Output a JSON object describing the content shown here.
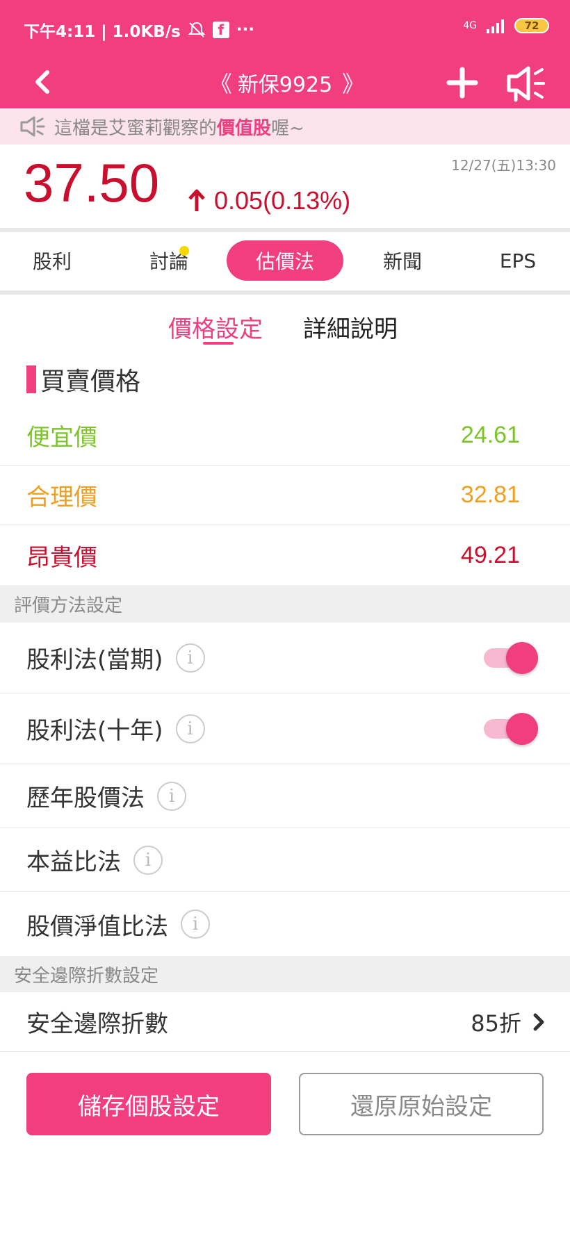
{
  "status": {
    "time_speed": "下午4:11 | 1.0KB/s",
    "network": "4G",
    "battery": "72"
  },
  "nav": {
    "title": "新保9925",
    "prev_arrow": "《",
    "next_arrow": "》"
  },
  "banner": {
    "prefix": "這檔是艾蜜莉觀察的",
    "highlight": "價值股",
    "suffix": "喔~"
  },
  "quote": {
    "price": "37.50",
    "change": "0.05(0.13%)",
    "datetime": "12/27(五)13:30",
    "color": "#c8102e"
  },
  "tabs": [
    {
      "label": "股利"
    },
    {
      "label": "討論"
    },
    {
      "label": "估價法"
    },
    {
      "label": "新聞"
    },
    {
      "label": "EPS"
    }
  ],
  "subtabs": {
    "price_setting": "價格設定",
    "detail": "詳細說明"
  },
  "section": {
    "title": "買賣價格"
  },
  "prices": [
    {
      "label": "便宜價",
      "value": "24.61",
      "color": "#7cc42a"
    },
    {
      "label": "合理價",
      "value": "32.81",
      "color": "#f0a020"
    },
    {
      "label": "昂貴價",
      "value": "49.21",
      "color": "#c8102e"
    }
  ],
  "method_header": "評價方法設定",
  "methods": [
    {
      "label": "股利法(當期)",
      "enabled": true
    },
    {
      "label": "股利法(十年)",
      "enabled": true
    },
    {
      "label": "歷年股價法"
    },
    {
      "label": "本益比法"
    },
    {
      "label": "股價淨值比法"
    }
  ],
  "safety_header": "安全邊際折數設定",
  "safety": {
    "label": "安全邊際折數",
    "value": "85折"
  },
  "buttons": {
    "save": "儲存個股設定",
    "reset": "還原原始設定"
  },
  "accent_color": "#f03e7e"
}
